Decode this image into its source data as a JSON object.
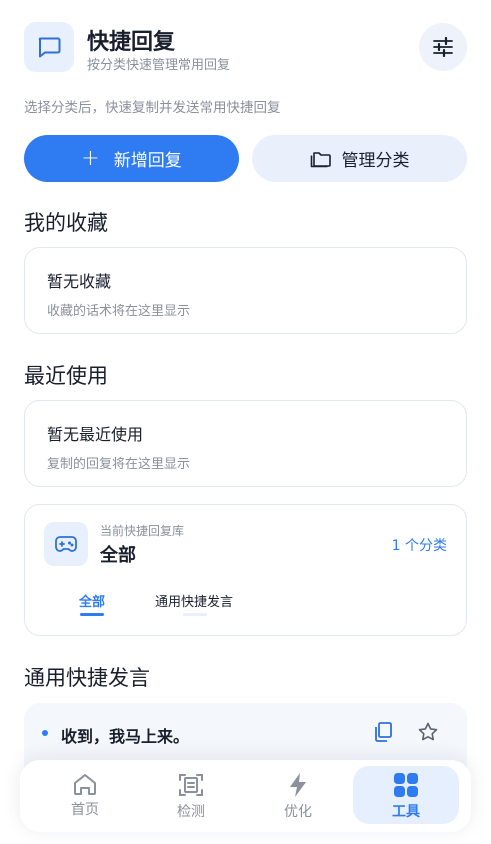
{
  "header": {
    "title": "快捷回复",
    "subtitle": "按分类快速管理常用回复"
  },
  "hint": "选择分类后，快速复制并发送常用快捷回复",
  "actions": {
    "add_label": "新增回复",
    "manage_label": "管理分类"
  },
  "favorites": {
    "section_title": "我的收藏",
    "empty_title": "暂无收藏",
    "empty_sub": "收藏的话术将在这里显示"
  },
  "recent": {
    "section_title": "最近使用",
    "empty_title": "暂无最近使用",
    "empty_sub": "复制的回复将在这里显示"
  },
  "library": {
    "label": "当前快捷回复库",
    "name": "全部",
    "count": "1 个分类",
    "tabs": [
      {
        "label": "全部",
        "active": true
      },
      {
        "label": "通用快捷发言",
        "active": false
      }
    ]
  },
  "category": {
    "section_title": "通用快捷发言",
    "replies": [
      {
        "text": "收到，我马上来。"
      }
    ]
  },
  "nav": {
    "items": [
      {
        "label": "首页",
        "icon": "home-icon"
      },
      {
        "label": "检测",
        "icon": "scan-icon"
      },
      {
        "label": "优化",
        "icon": "bolt-icon"
      },
      {
        "label": "工具",
        "icon": "grid-icon",
        "active": true
      }
    ]
  },
  "colors": {
    "accent": "#2f7cf2",
    "accent_soft": "#e9f0fc",
    "muted_text": "#8a909c"
  }
}
